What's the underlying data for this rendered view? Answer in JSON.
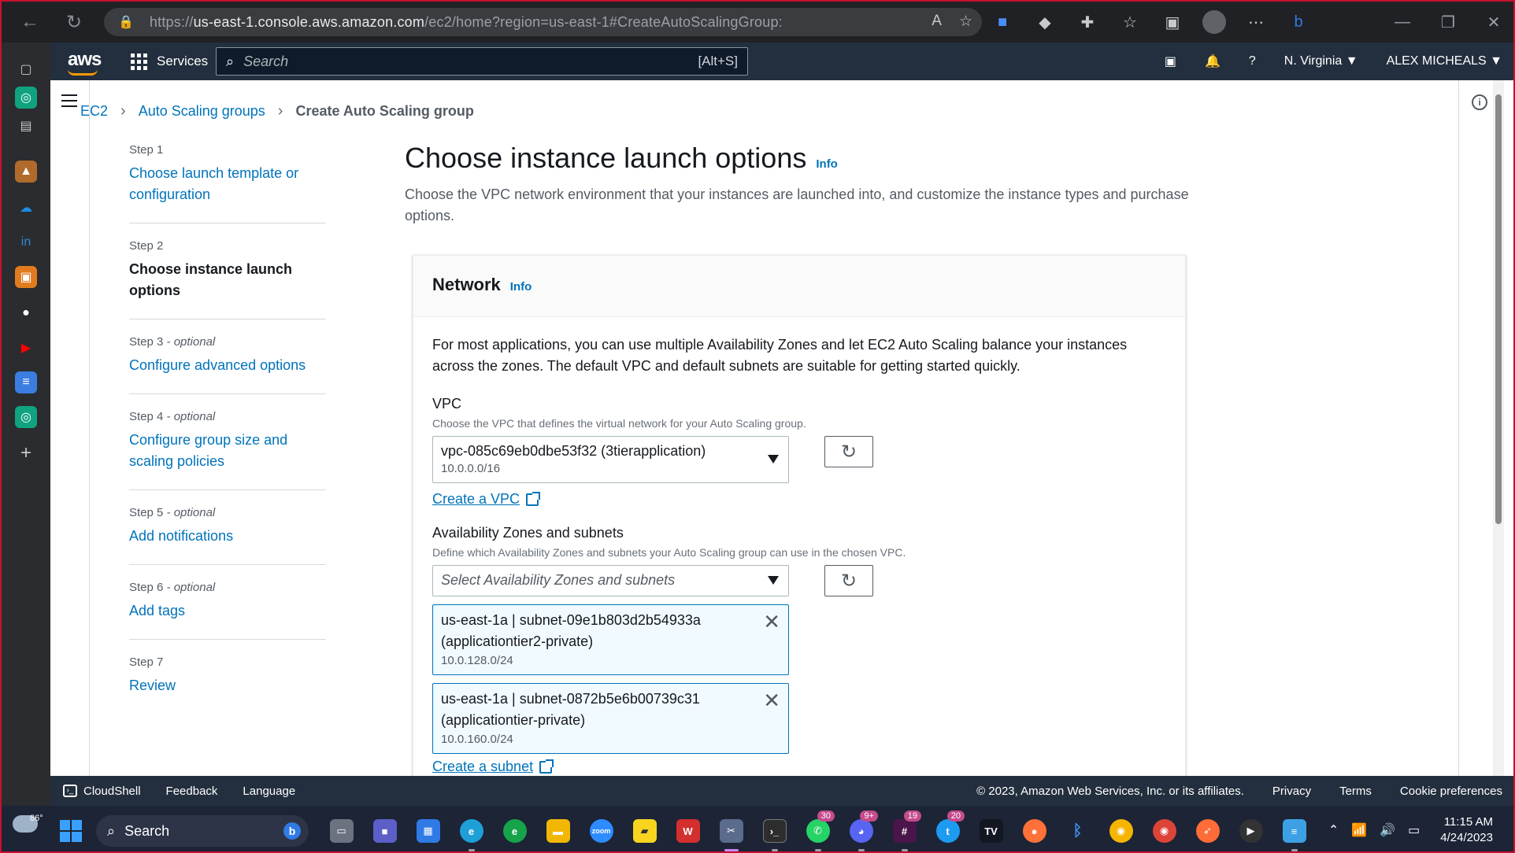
{
  "browser": {
    "url_prefix": "https://",
    "url_host": "us-east-1.console.aws.amazon.com",
    "url_path": "/ec2/home?region=us-east-1#CreateAutoScalingGroup:"
  },
  "aws_nav": {
    "logo": "aws",
    "services_label": "Services",
    "search_placeholder": "Search",
    "search_shortcut": "[Alt+S]",
    "region": "N. Virginia ▼",
    "account": "ALEX MICHEALS ▼"
  },
  "breadcrumb": {
    "items": [
      "EC2",
      "Auto Scaling groups"
    ],
    "current": "Create Auto Scaling group"
  },
  "steps": [
    {
      "num": "Step 1",
      "optional": "",
      "title": "Choose launch template or configuration",
      "active": false
    },
    {
      "num": "Step 2",
      "optional": "",
      "title": "Choose instance launch options",
      "active": true
    },
    {
      "num": "Step 3",
      "optional": " - optional",
      "title": "Configure advanced options",
      "active": false
    },
    {
      "num": "Step 4",
      "optional": " - optional",
      "title": "Configure group size and scaling policies",
      "active": false
    },
    {
      "num": "Step 5",
      "optional": " - optional",
      "title": "Add notifications",
      "active": false
    },
    {
      "num": "Step 6",
      "optional": " - optional",
      "title": "Add tags",
      "active": false
    },
    {
      "num": "Step 7",
      "optional": "",
      "title": "Review",
      "active": false
    }
  ],
  "main": {
    "title": "Choose instance launch options",
    "info": "Info",
    "description": "Choose the VPC network environment that your instances are launched into, and customize the instance types and purchase options."
  },
  "network": {
    "title": "Network",
    "info": "Info",
    "paragraph": "For most applications, you can use multiple Availability Zones and let EC2 Auto Scaling balance your instances across the zones. The default VPC and default subnets are suitable for getting started quickly.",
    "vpc_label": "VPC",
    "vpc_hint": "Choose the VPC that defines the virtual network for your Auto Scaling group.",
    "vpc_value": "vpc-085c69eb0dbe53f32 (3tierapplication)",
    "vpc_cidr": "10.0.0.0/16",
    "create_vpc": "Create a VPC",
    "az_label": "Availability Zones and subnets",
    "az_hint": "Define which Availability Zones and subnets your Auto Scaling group can use in the chosen VPC.",
    "az_placeholder": "Select Availability Zones and subnets",
    "subnets": [
      {
        "line1": "us-east-1a | subnet-09e1b803d2b54933a",
        "line2": "(applicationtier2-private)",
        "cidr": "10.0.128.0/24"
      },
      {
        "line1": "us-east-1a | subnet-0872b5e6b00739c31",
        "line2": "(applicationtier-private)",
        "cidr": "10.0.160.0/24"
      }
    ],
    "create_subnet": "Create a subnet"
  },
  "footer": {
    "cloudshell": "CloudShell",
    "feedback": "Feedback",
    "language": "Language",
    "copyright": "© 2023, Amazon Web Services, Inc. or its affiliates.",
    "privacy": "Privacy",
    "terms": "Terms",
    "cookies": "Cookie preferences"
  },
  "taskbar": {
    "weather": "86°",
    "search": "Search",
    "badge_whatsapp": "30",
    "badge_discord": "9+",
    "badge_slack": "19",
    "badge_twitter": "20",
    "time": "11:15 AM",
    "date": "4/24/2023"
  }
}
